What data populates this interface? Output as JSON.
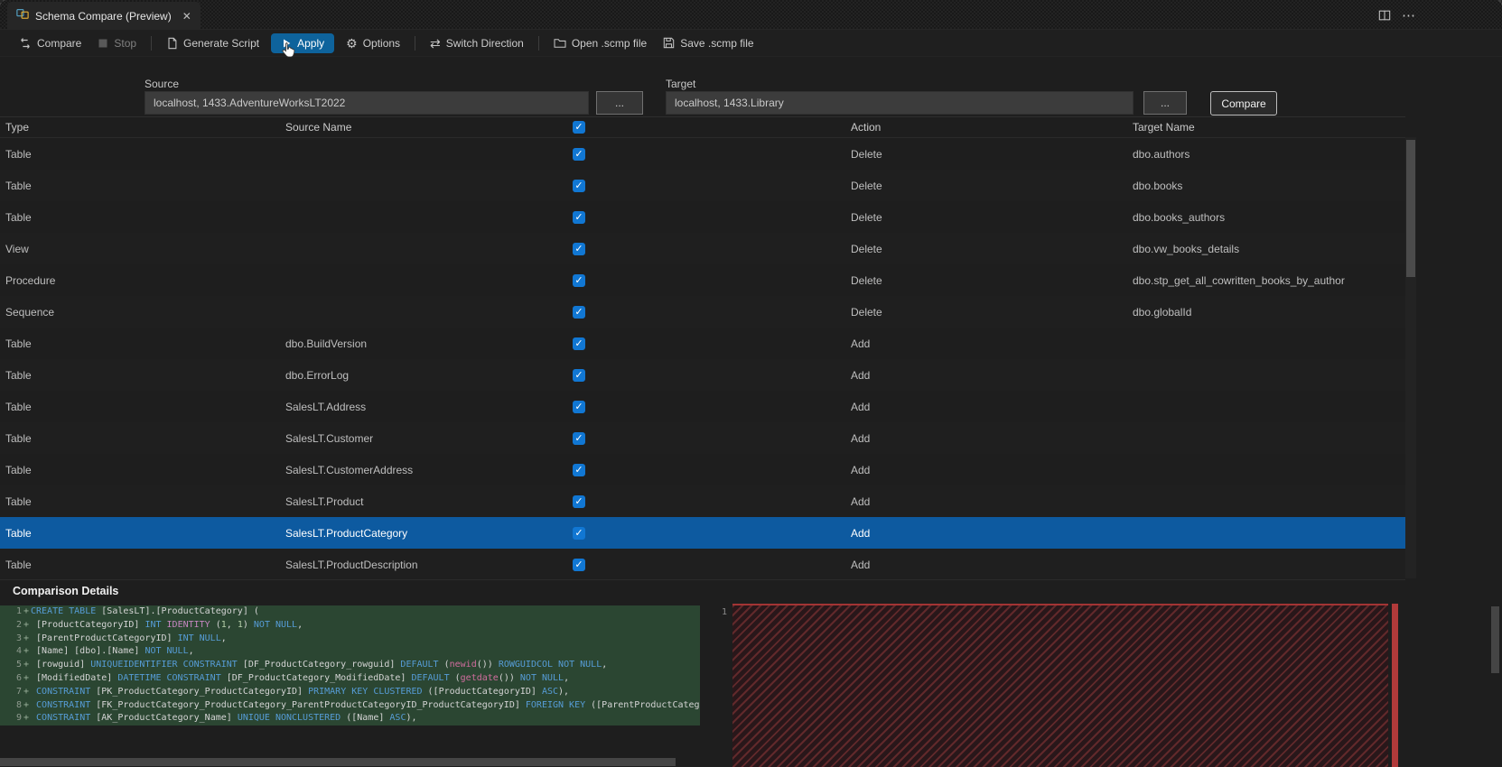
{
  "colors": {
    "accent": "#0e639c",
    "checkbox": "#1177d3",
    "selected_row": "#0d5aa0",
    "added_line_bg": "#2b4632",
    "overview_removed": "#b13a3a"
  },
  "window": {
    "tab_title": "Schema Compare (Preview)",
    "icons": {
      "close": "✕",
      "more": "⋯"
    }
  },
  "toolbar": {
    "items": [
      {
        "name": "compare",
        "label": "Compare",
        "icon": "compare-icon"
      },
      {
        "name": "stop",
        "label": "Stop",
        "icon": "stop-icon",
        "disabled": true
      },
      {
        "name": "generate-script",
        "label": "Generate Script",
        "icon": "script-icon",
        "separator_before": true
      },
      {
        "name": "apply",
        "label": "Apply",
        "icon": "play-icon",
        "active": true
      },
      {
        "name": "options",
        "label": "Options",
        "icon": "gear-icon"
      },
      {
        "name": "switch-direction",
        "label": "Switch Direction",
        "icon": "switch-direction-icon",
        "separator_before": true
      },
      {
        "name": "open-scmp",
        "label": "Open .scmp file",
        "icon": "open-file-icon",
        "separator_before": true
      },
      {
        "name": "save-scmp",
        "label": "Save .scmp file",
        "icon": "save-icon"
      }
    ]
  },
  "connections": {
    "source": {
      "label": "Source",
      "value": "localhost, 1433.AdventureWorksLT2022"
    },
    "target": {
      "label": "Target",
      "value": "localhost, 1433.Library"
    },
    "browse_label": "...",
    "compare_label": "Compare"
  },
  "grid": {
    "headers": {
      "type": "Type",
      "source_name": "Source Name",
      "action": "Action",
      "target_name": "Target Name"
    },
    "check_glyph": "✓",
    "rows": [
      {
        "type": "Table",
        "source": "",
        "checked": true,
        "action": "Delete",
        "target": "dbo.authors"
      },
      {
        "type": "Table",
        "source": "",
        "checked": true,
        "action": "Delete",
        "target": "dbo.books"
      },
      {
        "type": "Table",
        "source": "",
        "checked": true,
        "action": "Delete",
        "target": "dbo.books_authors"
      },
      {
        "type": "View",
        "source": "",
        "checked": true,
        "action": "Delete",
        "target": "dbo.vw_books_details"
      },
      {
        "type": "Procedure",
        "source": "",
        "checked": true,
        "action": "Delete",
        "target": "dbo.stp_get_all_cowritten_books_by_author"
      },
      {
        "type": "Sequence",
        "source": "",
        "checked": true,
        "action": "Delete",
        "target": "dbo.globalId"
      },
      {
        "type": "Table",
        "source": "dbo.BuildVersion",
        "checked": true,
        "action": "Add",
        "target": ""
      },
      {
        "type": "Table",
        "source": "dbo.ErrorLog",
        "checked": true,
        "action": "Add",
        "target": ""
      },
      {
        "type": "Table",
        "source": "SalesLT.Address",
        "checked": true,
        "action": "Add",
        "target": ""
      },
      {
        "type": "Table",
        "source": "SalesLT.Customer",
        "checked": true,
        "action": "Add",
        "target": ""
      },
      {
        "type": "Table",
        "source": "SalesLT.CustomerAddress",
        "checked": true,
        "action": "Add",
        "target": ""
      },
      {
        "type": "Table",
        "source": "SalesLT.Product",
        "checked": true,
        "action": "Add",
        "target": ""
      },
      {
        "type": "Table",
        "source": "SalesLT.ProductCategory",
        "checked": true,
        "action": "Add",
        "target": "",
        "selected": true
      },
      {
        "type": "Table",
        "source": "SalesLT.ProductDescription",
        "checked": true,
        "action": "Add",
        "target": ""
      }
    ]
  },
  "details": {
    "title": "Comparison Details",
    "added_sign": "+",
    "left": {
      "lines": [
        {
          "num": 1,
          "tokens": [
            {
              "c": "kw",
              "t": "CREATE TABLE "
            },
            {
              "c": "pl",
              "t": "[SalesLT].[ProductCategory] ("
            }
          ]
        },
        {
          "num": 2,
          "tokens": [
            {
              "c": "pl",
              "t": " [ProductCategoryID] "
            },
            {
              "c": "kw",
              "t": "INT "
            },
            {
              "c": "mg",
              "t": "IDENTITY "
            },
            {
              "c": "pl",
              "t": "("
            },
            {
              "c": "num",
              "t": "1"
            },
            {
              "c": "pl",
              "t": ", "
            },
            {
              "c": "num",
              "t": "1"
            },
            {
              "c": "pl",
              "t": ") "
            },
            {
              "c": "kw",
              "t": "NOT NULL"
            },
            {
              "c": "pl",
              "t": ","
            }
          ]
        },
        {
          "num": 3,
          "tokens": [
            {
              "c": "pl",
              "t": " [ParentProductCategoryID] "
            },
            {
              "c": "kw",
              "t": "INT NULL"
            },
            {
              "c": "pl",
              "t": ","
            }
          ]
        },
        {
          "num": 4,
          "tokens": [
            {
              "c": "pl",
              "t": " [Name] [dbo].[Name] "
            },
            {
              "c": "kw",
              "t": "NOT NULL"
            },
            {
              "c": "pl",
              "t": ","
            }
          ]
        },
        {
          "num": 5,
          "tokens": [
            {
              "c": "pl",
              "t": " [rowguid] "
            },
            {
              "c": "kw",
              "t": "UNIQUEIDENTIFIER CONSTRAINT "
            },
            {
              "c": "pl",
              "t": "[DF_ProductCategory_rowguid] "
            },
            {
              "c": "kw",
              "t": "DEFAULT "
            },
            {
              "c": "pl",
              "t": "("
            },
            {
              "c": "fn",
              "t": "newid"
            },
            {
              "c": "pl",
              "t": "()) "
            },
            {
              "c": "kw",
              "t": "ROWGUIDCOL NOT NULL"
            },
            {
              "c": "pl",
              "t": ","
            }
          ]
        },
        {
          "num": 6,
          "tokens": [
            {
              "c": "pl",
              "t": " [ModifiedDate] "
            },
            {
              "c": "kw",
              "t": "DATETIME CONSTRAINT "
            },
            {
              "c": "pl",
              "t": "[DF_ProductCategory_ModifiedDate] "
            },
            {
              "c": "kw",
              "t": "DEFAULT "
            },
            {
              "c": "pl",
              "t": "("
            },
            {
              "c": "fn",
              "t": "getdate"
            },
            {
              "c": "pl",
              "t": "()) "
            },
            {
              "c": "kw",
              "t": "NOT NULL"
            },
            {
              "c": "pl",
              "t": ","
            }
          ]
        },
        {
          "num": 7,
          "tokens": [
            {
              "c": "pl",
              "t": " "
            },
            {
              "c": "kw",
              "t": "CONSTRAINT "
            },
            {
              "c": "pl",
              "t": "[PK_ProductCategory_ProductCategoryID] "
            },
            {
              "c": "kw",
              "t": "PRIMARY KEY CLUSTERED "
            },
            {
              "c": "pl",
              "t": "([ProductCategoryID] "
            },
            {
              "c": "kw",
              "t": "ASC"
            },
            {
              "c": "pl",
              "t": "),"
            }
          ]
        },
        {
          "num": 8,
          "tokens": [
            {
              "c": "pl",
              "t": " "
            },
            {
              "c": "kw",
              "t": "CONSTRAINT "
            },
            {
              "c": "pl",
              "t": "[FK_ProductCategory_ProductCategory_ParentProductCategoryID_ProductCategoryID] "
            },
            {
              "c": "kw",
              "t": "FOREIGN KEY "
            },
            {
              "c": "pl",
              "t": "([ParentProductCatego"
            }
          ]
        },
        {
          "num": 9,
          "tokens": [
            {
              "c": "pl",
              "t": " "
            },
            {
              "c": "kw",
              "t": "CONSTRAINT "
            },
            {
              "c": "pl",
              "t": "[AK_ProductCategory_Name] "
            },
            {
              "c": "kw",
              "t": "UNIQUE NONCLUSTERED "
            },
            {
              "c": "pl",
              "t": "([Name] "
            },
            {
              "c": "kw",
              "t": "ASC"
            },
            {
              "c": "pl",
              "t": "),"
            }
          ]
        }
      ]
    },
    "right": {
      "first_line_number": "1"
    }
  }
}
